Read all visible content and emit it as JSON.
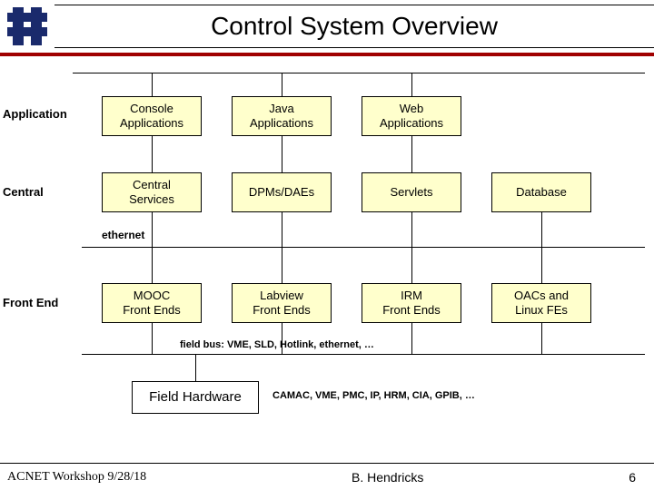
{
  "title": "Control System Overview",
  "row_labels": {
    "app": "Application",
    "central": "Central",
    "frontend": "Front End"
  },
  "ethernet_label": "ethernet",
  "boxes": {
    "console_apps": "Console\nApplications",
    "java_apps": "Java\nApplications",
    "web_apps": "Web\nApplications",
    "central_services": "Central\nServices",
    "dpms": "DPMs/DAEs",
    "servlets": "Servlets",
    "database": "Database",
    "mooc": "MOOC\nFront Ends",
    "labview": "Labview\nFront Ends",
    "irm": "IRM\nFront Ends",
    "oacs": "OACs and\nLinux FEs",
    "field_hw": "Field Hardware"
  },
  "notes": {
    "fieldbus": "field bus: VME, SLD, Hotlink, ethernet, …",
    "camac": "CAMAC, VME, PMC, IP, HRM, CIA, GPIB, …"
  },
  "footer": {
    "left": "ACNET Workshop 9/28/18",
    "center": "B. Hendricks",
    "right": "6"
  }
}
